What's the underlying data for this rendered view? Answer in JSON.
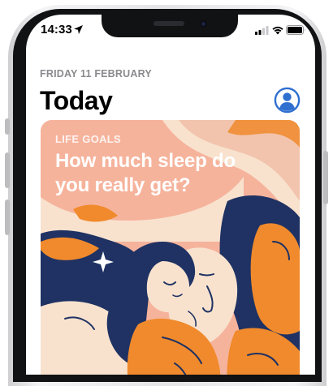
{
  "status_bar": {
    "time": "14:33",
    "icons": [
      "location-arrow-icon",
      "cellular-signal-icon",
      "wifi-icon",
      "battery-icon"
    ]
  },
  "header": {
    "date": "FRIDAY 11 FEBRUARY",
    "title": "Today",
    "account_icon": "person-circle-icon"
  },
  "card": {
    "eyebrow": "LIFE GOALS",
    "title": "How much sleep do you really get?"
  },
  "colors": {
    "accent_blue": "#2f6fd0",
    "card_salmon": "#f6b39c",
    "illustration_navy": "#1f3263",
    "illustration_orange": "#f08a2c",
    "illustration_cream": "#f8e2ce"
  }
}
